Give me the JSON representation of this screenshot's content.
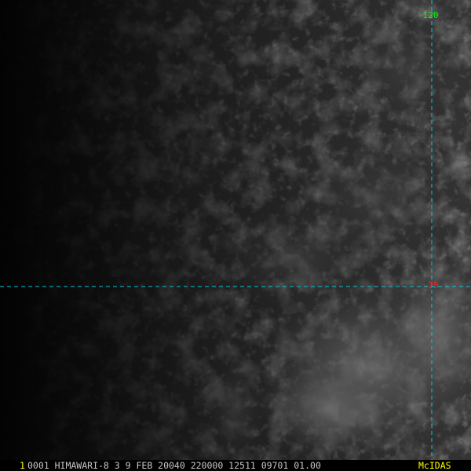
{
  "overlay": {
    "longitude_label": "-120",
    "latitude_label": "-25",
    "grid_color": "#00c8d8",
    "longitude_label_color": "#00ff00",
    "latitude_label_color": "#ff2020"
  },
  "status_bar": {
    "frame_number": "1",
    "frame_number_color": "#ffff00",
    "text": "0001 HIMAWARI-8  3  9 FEB 20040 220000 12511 09701 01.00",
    "text_color": "#c8c8c8",
    "brand": "McIDAS",
    "brand_color": "#ffff00"
  }
}
